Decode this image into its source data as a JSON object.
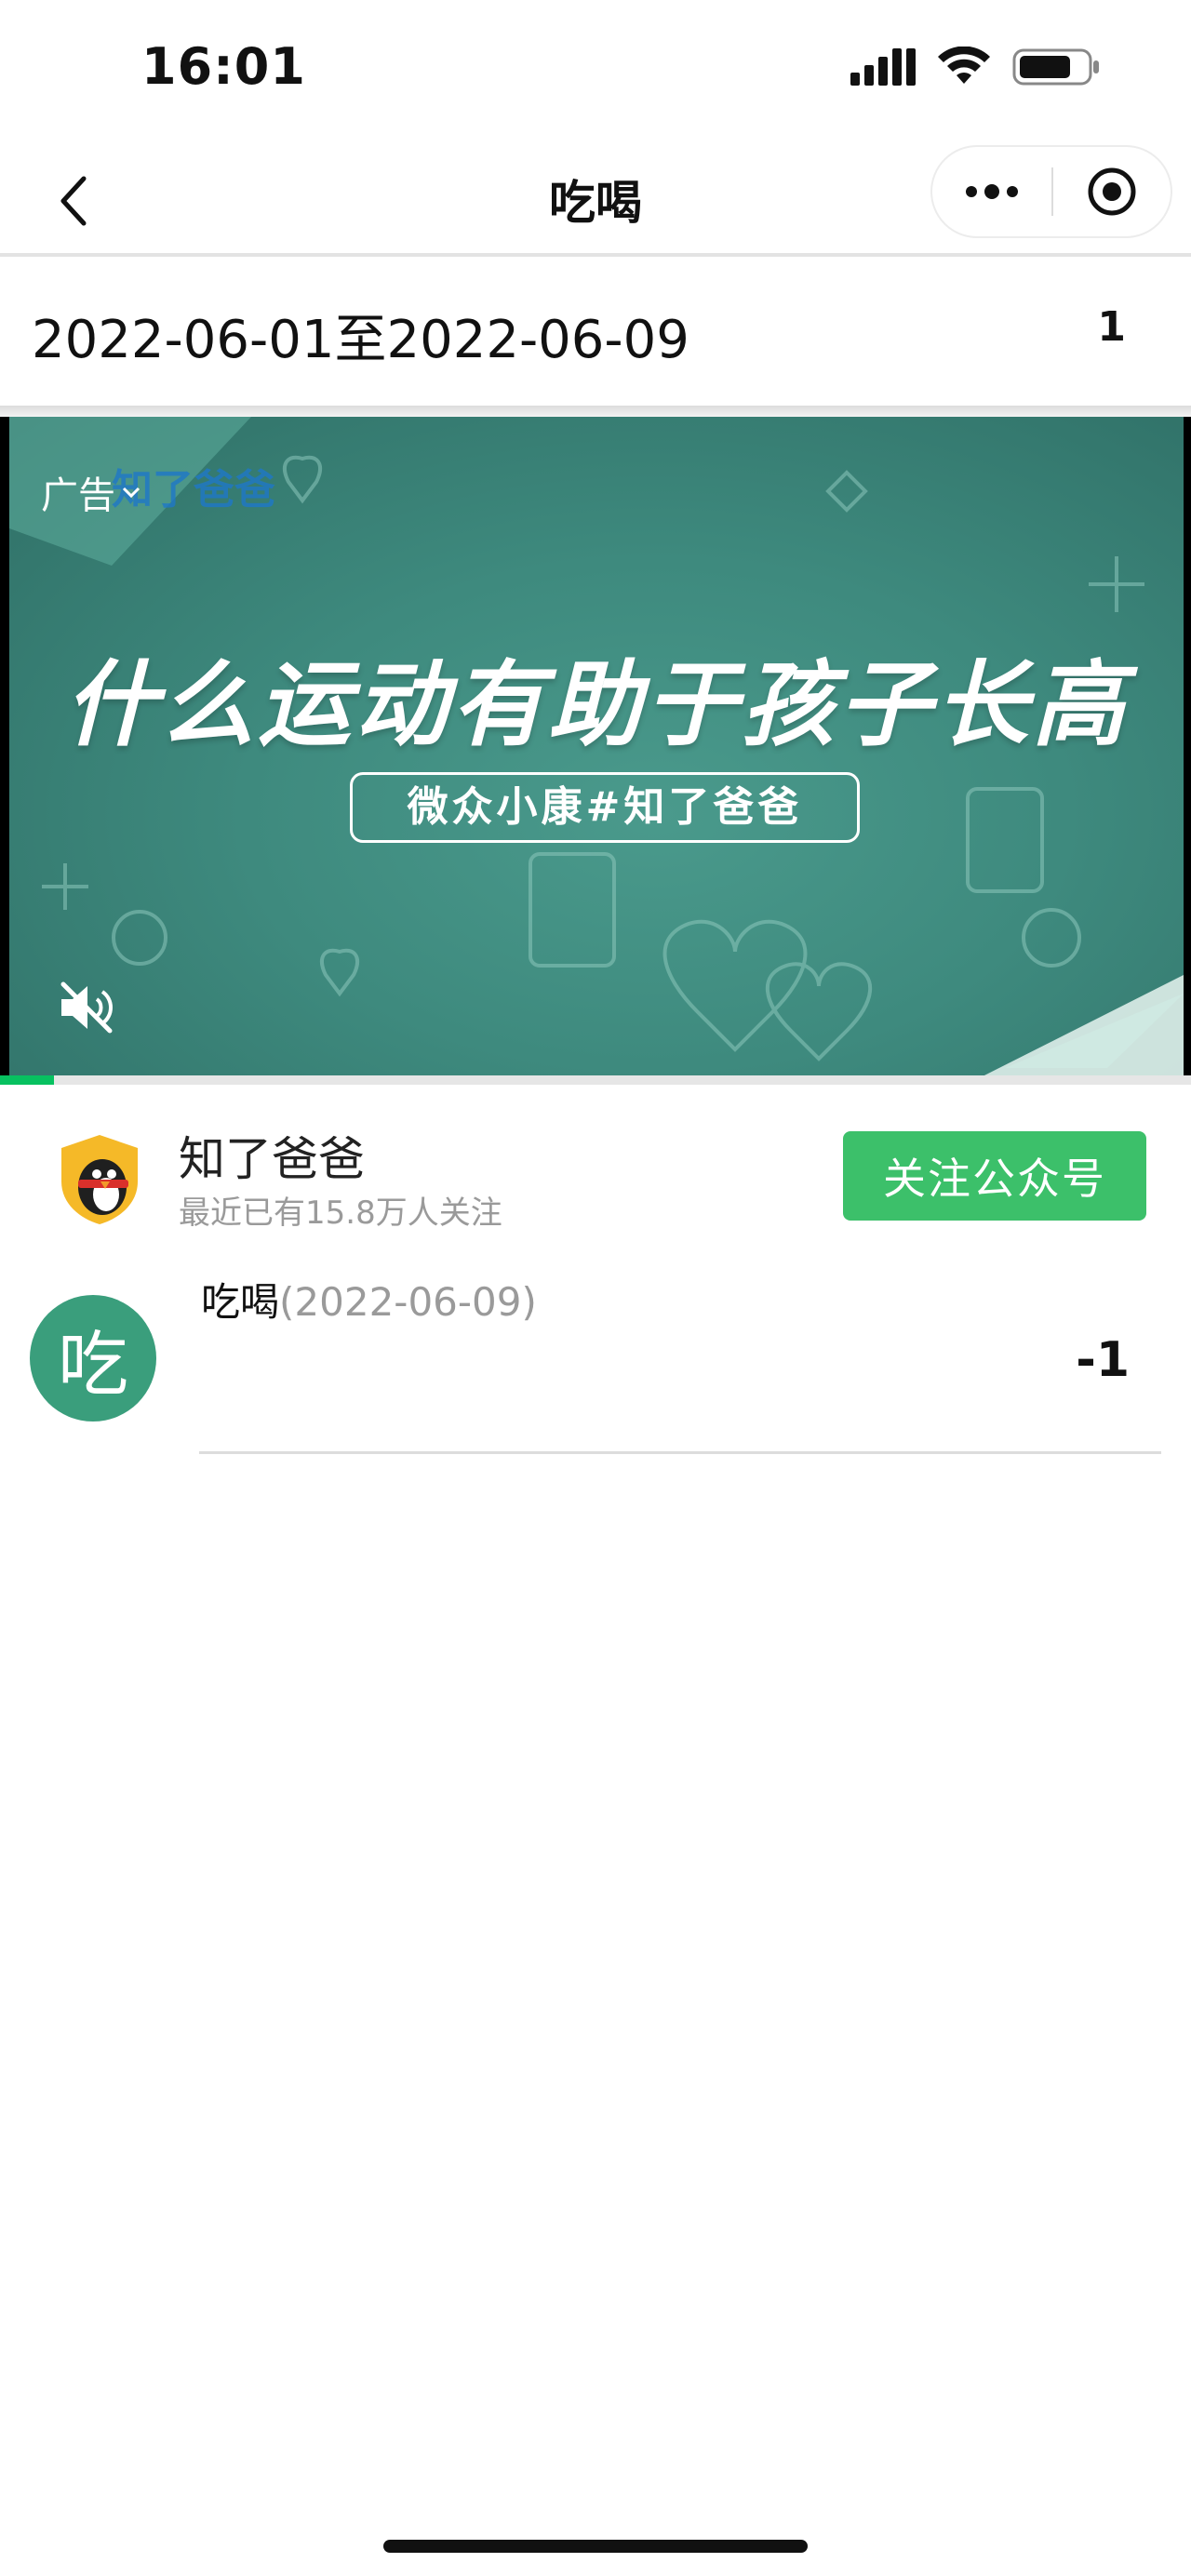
{
  "status_bar": {
    "time": "16:01",
    "icons": [
      "signal-icon",
      "wifi-icon",
      "battery-icon"
    ]
  },
  "nav": {
    "title": "吃喝",
    "back_icon": "chevron-left-icon",
    "more_icon": "more-dots-icon",
    "close_icon": "target-close-icon"
  },
  "range": {
    "text": "2022-06-01至2022-06-09",
    "count": "1"
  },
  "ad": {
    "label": "广告",
    "brand": "知了爸爸",
    "headline": "什么运动有助于孩子长高",
    "tag": "微众小康#知了爸爸",
    "progress": 0.045,
    "mute_icon": "mute-icon"
  },
  "official_account": {
    "name": "知了爸爸",
    "subtitle": "最近已有15.8万人关注",
    "follow_label": "关注公众号"
  },
  "records": [
    {
      "avatar_char": "吃",
      "title": "吃喝",
      "date": "(2022-06-09)",
      "value": "-1"
    }
  ],
  "colors": {
    "accent_green": "#07c160",
    "follow_button": "#3cc06a",
    "avatar_green": "#3a9e7c",
    "ad_background": "#3e8a7e"
  }
}
